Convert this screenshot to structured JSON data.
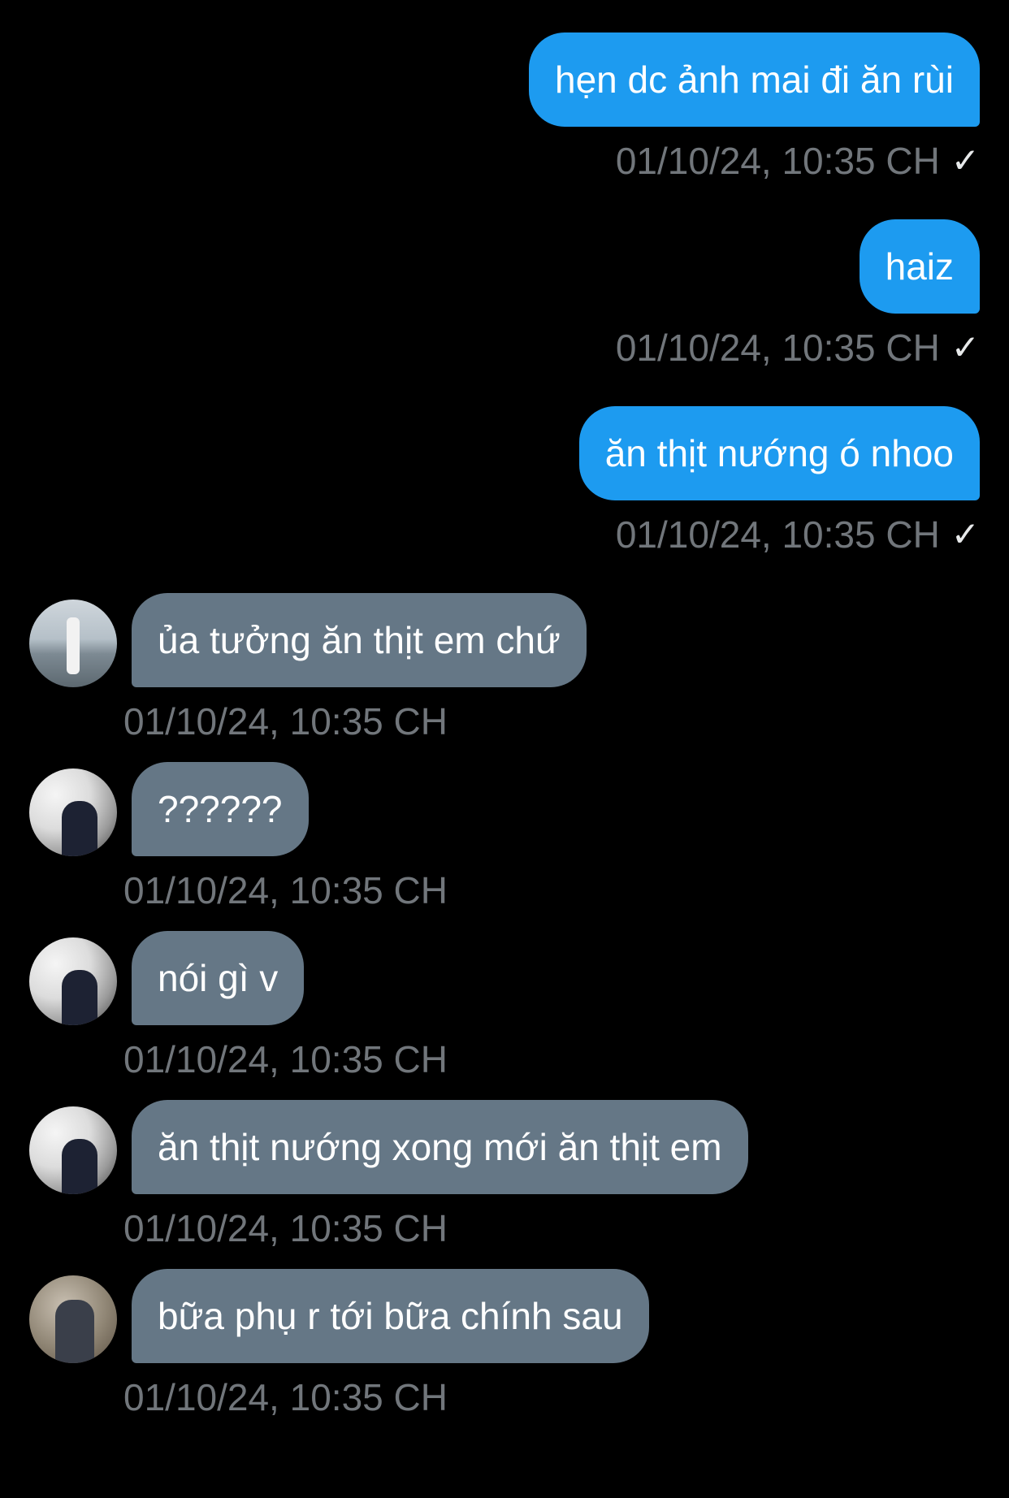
{
  "messages": [
    {
      "direction": "out",
      "text": "hẹn dc ảnh mai đi ăn rùi",
      "time": "01/10/24, 10:35 CH",
      "status_icon": "check-icon"
    },
    {
      "direction": "out",
      "text": "haiz",
      "time": "01/10/24, 10:35 CH",
      "status_icon": "check-icon"
    },
    {
      "direction": "out",
      "text": "ăn thịt nướng ó nhoo",
      "time": "01/10/24, 10:35 CH",
      "status_icon": "check-icon"
    },
    {
      "direction": "in",
      "text": "ủa tưởng ăn thịt em chứ",
      "time": "01/10/24, 10:35 CH",
      "avatar_icon": "avatar-photo-icon"
    },
    {
      "direction": "in",
      "text": "??????",
      "time": "01/10/24, 10:35 CH",
      "avatar_icon": "avatar-photo-icon"
    },
    {
      "direction": "in",
      "text": "nói gì v",
      "time": "01/10/24, 10:35 CH",
      "avatar_icon": "avatar-photo-icon"
    },
    {
      "direction": "in",
      "text": "ăn thịt nướng xong mới ăn thịt em",
      "time": "01/10/24, 10:35 CH",
      "avatar_icon": "avatar-photo-icon"
    },
    {
      "direction": "in",
      "text": "bữa phụ r tới bữa chính sau",
      "time": "01/10/24, 10:35 CH",
      "avatar_icon": "avatar-photo-icon"
    }
  ],
  "check_glyph": "✓",
  "colors": {
    "background": "#000000",
    "outgoing_bubble": "#1d9bf0",
    "incoming_bubble": "#657786",
    "timestamp": "#71767b"
  }
}
